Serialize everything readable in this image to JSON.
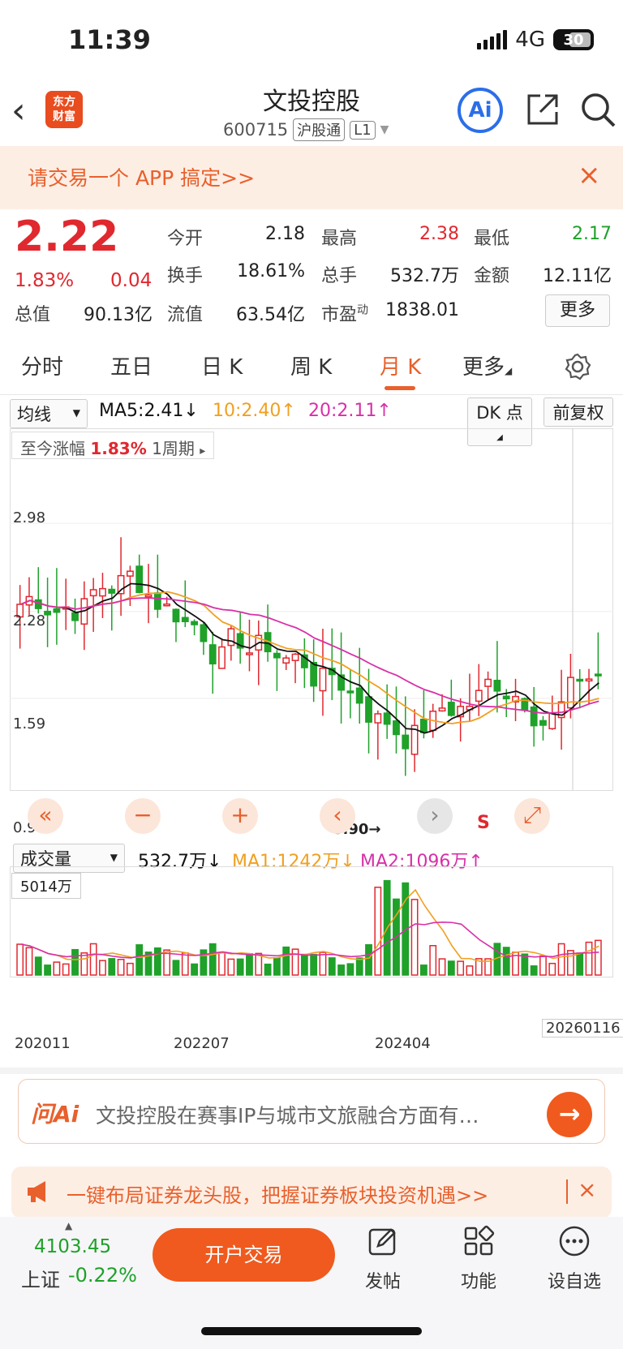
{
  "status": {
    "time": "11:39",
    "network": "4G",
    "battery": "30"
  },
  "header": {
    "back": "‹",
    "logo": [
      "东方",
      "财富"
    ],
    "title": "文投控股",
    "code": "600715",
    "tag1": "沪股通",
    "tag2": "L1",
    "ai": "Ai"
  },
  "promo": {
    "text": "请交易一个 APP 搞定>>",
    "close": "×"
  },
  "quote": {
    "price": "2.22",
    "pct": "1.83%",
    "change": "0.04",
    "open_label": "今开",
    "open": "2.18",
    "high_label": "最高",
    "high": "2.38",
    "low_label": "最低",
    "low": "2.17",
    "turnover_label": "换手",
    "turnover": "18.61%",
    "volume_label": "总手",
    "volume": "532.7万",
    "amount_label": "金额",
    "amount": "12.11亿",
    "mcap_label": "总值",
    "mcap": "90.13亿",
    "float_label": "流值",
    "float": "63.54亿",
    "pe_label": "市盈",
    "pe_sup": "动",
    "pe": "1838.01",
    "more": "更多"
  },
  "tabs": [
    {
      "label": "分时"
    },
    {
      "label": "五日"
    },
    {
      "label": "日 K"
    },
    {
      "label": "周 K"
    },
    {
      "label": "月 K"
    },
    {
      "label": "更多"
    }
  ],
  "indicators": {
    "ma_select": "均线",
    "ma5": "MA5:2.41↓",
    "ma10": "10:2.40↑",
    "ma20": "20:2.11↑",
    "dk": "DK 点",
    "adjust": "前复权",
    "since_label": "至今涨幅",
    "since_val": "1.83%",
    "period": "1周期",
    "vol_select": "成交量",
    "vol_val": "532.7万↓",
    "vol_ma1": "MA1:1242万↓",
    "vol_ma2": "MA2:1096万↑",
    "vol_max": "5014万"
  },
  "chart_data": {
    "type": "candlestick",
    "y_ticks": [
      "2.98",
      "2.28",
      "1.59",
      "0.90"
    ],
    "ylim": [
      0.9,
      3.67
    ],
    "x_ticks": [
      "202011",
      "202207",
      "202404",
      "20260116"
    ],
    "min_marker": "0.90→",
    "signal": "S",
    "colors": {
      "up": "#e0282f",
      "down": "#1fa12a",
      "ma5": "#111111",
      "ma10": "#f0a020",
      "ma20": "#d830a8"
    }
  },
  "controls": {
    "left2": "«",
    "minus": "−",
    "plus": "+",
    "prev": "‹",
    "next": "›",
    "expand": "⤢"
  },
  "ask": {
    "logo": "问Ai",
    "text": "文投控股在赛事IP与城市文旅融合方面有…",
    "go": "→"
  },
  "ad": {
    "text": "一键布局证券龙头股，把握证券板块投资机遇>>",
    "close": "×"
  },
  "bottom": {
    "index_value": "4103.45",
    "index_name": "上证",
    "index_pct": "-0.22%",
    "open_btn": "开户交易",
    "nav": [
      {
        "label": "发帖"
      },
      {
        "label": "功能"
      },
      {
        "label": "设自选"
      }
    ]
  }
}
